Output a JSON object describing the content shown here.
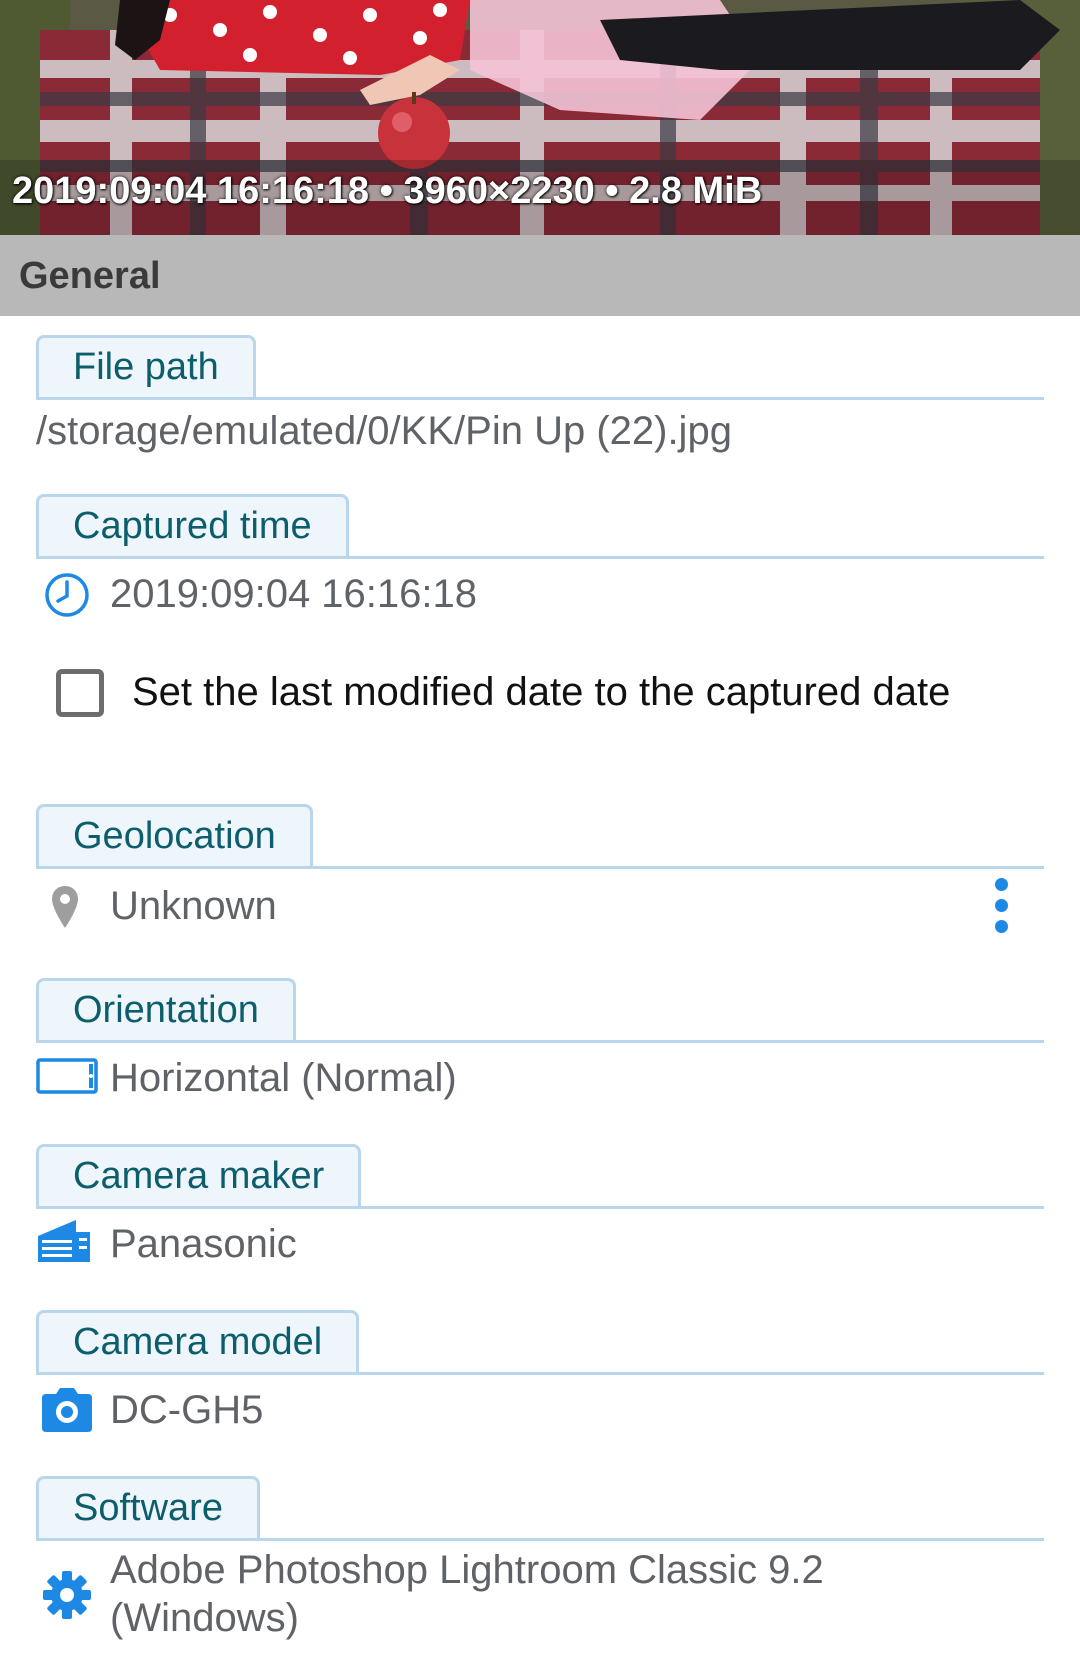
{
  "photo": {
    "caption": "2019:09:04 16:16:18 • 3960×2230 • 2.8 MiB"
  },
  "section": {
    "title": "General"
  },
  "fields": {
    "file_path": {
      "label": "File path",
      "value": "/storage/emulated/0/KK/Pin Up (22).jpg"
    },
    "captured_time": {
      "label": "Captured time",
      "value": "2019:09:04 16:16:18",
      "icon": "clock-icon"
    },
    "checkbox": {
      "label": "Set the last modified date to the captured date",
      "checked": false
    },
    "geolocation": {
      "label": "Geolocation",
      "value": "Unknown",
      "icon": "location-pin-icon"
    },
    "orientation": {
      "label": "Orientation",
      "value": "Horizontal (Normal)",
      "icon": "landscape-phone-icon"
    },
    "camera_maker": {
      "label": "Camera maker",
      "value": "Panasonic",
      "icon": "building-icon"
    },
    "camera_model": {
      "label": "Camera model",
      "value": "DC-GH5",
      "icon": "camera-icon"
    },
    "software": {
      "label": "Software",
      "value_line1": "Adobe Photoshop Lightroom Classic 9.2",
      "value_line2": "(Windows)",
      "icon": "gear-icon"
    }
  },
  "colors": {
    "accent": "#1e88e5",
    "label_text": "#0d5e6c",
    "label_bg": "#eef5fb",
    "label_border": "#b9d6ea",
    "header_bg": "#b8b8b8"
  }
}
